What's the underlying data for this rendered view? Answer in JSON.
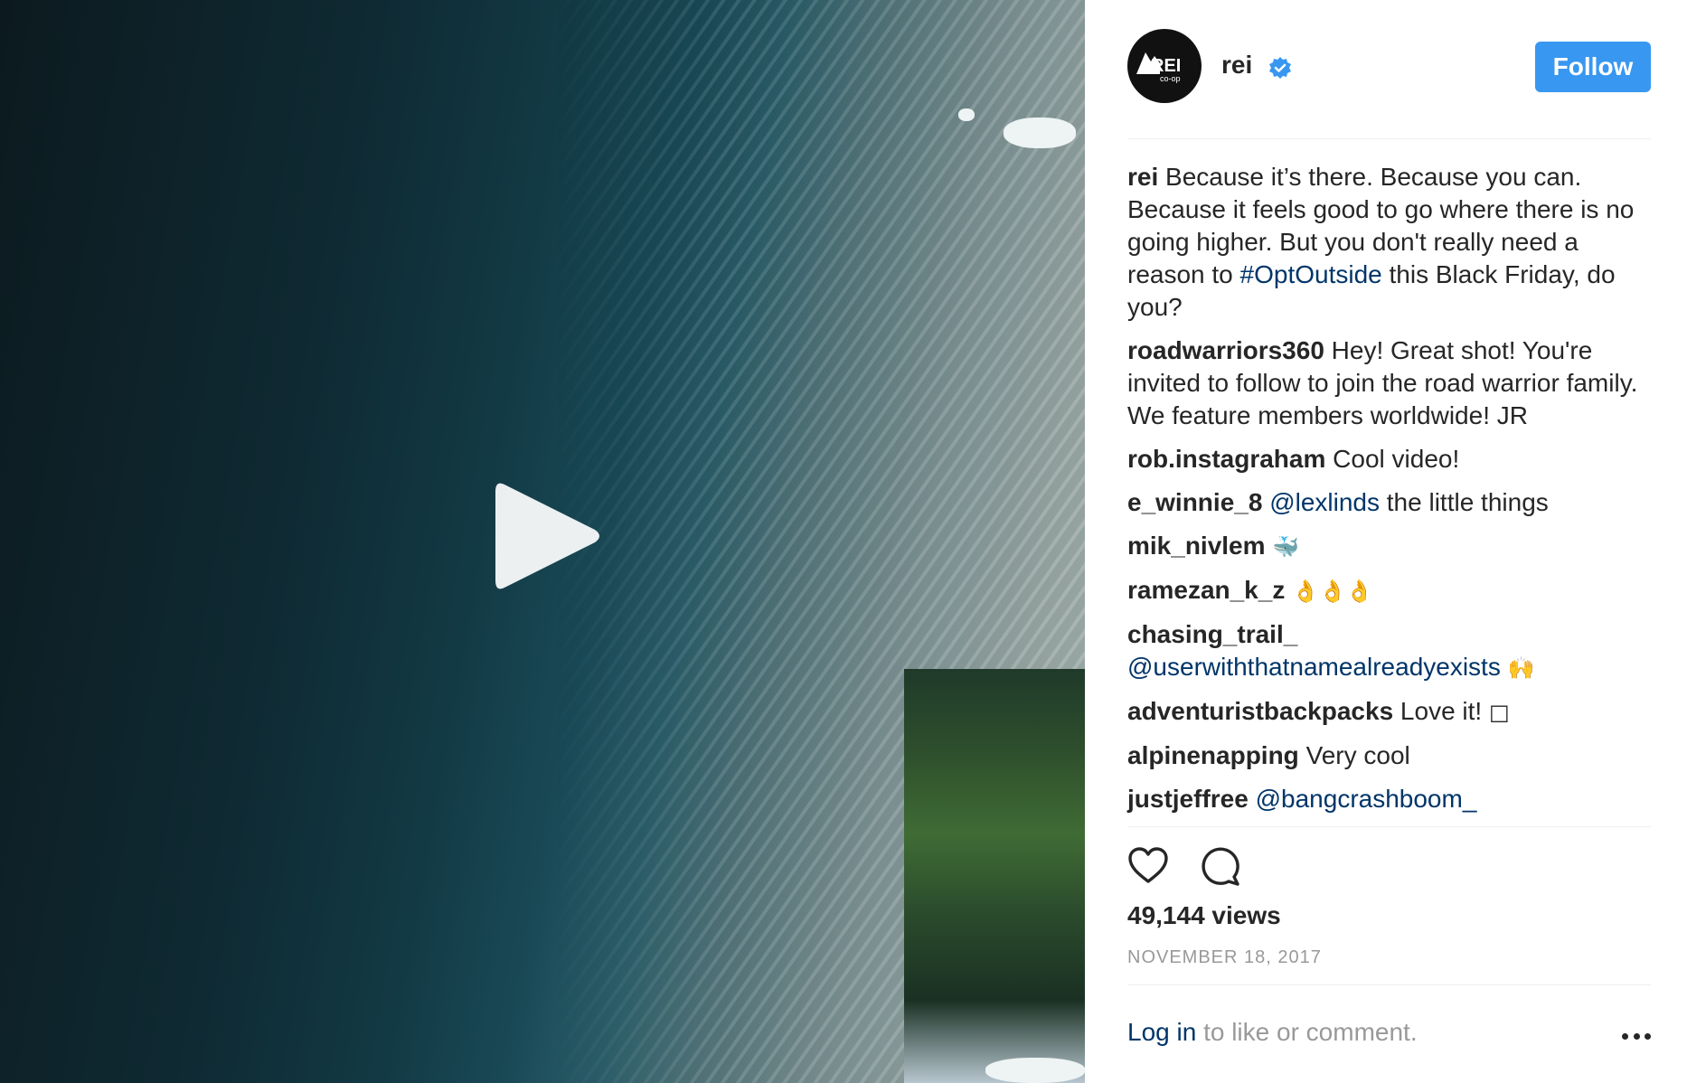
{
  "post": {
    "media": {
      "play_icon": "play-icon"
    },
    "header": {
      "username": "rei",
      "avatar_text": "REI",
      "avatar_subtext": "co-op",
      "verified_icon": "verified-badge-icon",
      "follow_label": "Follow"
    },
    "comments": [
      {
        "author": "rei",
        "segments": [
          {
            "text": "Because it’s there. Because you can. Because it feels good to go where there is no going higher. But you don't really need a reason to "
          },
          {
            "text": "#OptOutside",
            "link": true
          },
          {
            "text": " this Black Friday, do you?"
          }
        ]
      },
      {
        "author": "roadwarriors360",
        "segments": [
          {
            "text": "Hey! Great shot! You're invited to follow to join the road warrior family. We feature members worldwide! JR"
          }
        ]
      },
      {
        "author": "rob.instagraham",
        "segments": [
          {
            "text": "Cool video!"
          }
        ]
      },
      {
        "author": "e_winnie_8",
        "segments": [
          {
            "text": "@lexlinds",
            "link": true
          },
          {
            "text": " the little things"
          }
        ]
      },
      {
        "author": "mik_nivlem",
        "segments": [
          {
            "text": "🐳",
            "emoji": true
          }
        ]
      },
      {
        "author": "ramezan_k_z",
        "segments": [
          {
            "text": "👌👌👌",
            "emoji": true
          }
        ]
      },
      {
        "author": "chasing_trail_",
        "segments": [
          {
            "text": "@userwiththatnamealreadyexists",
            "link": true
          },
          {
            "text": " "
          },
          {
            "text": "🙌",
            "emoji": true
          }
        ]
      },
      {
        "author": "adventuristbackpacks",
        "segments": [
          {
            "text": "Love it! "
          },
          {
            "text": "□",
            "emoji": true
          }
        ]
      },
      {
        "author": "alpinenapping",
        "segments": [
          {
            "text": "Very cool"
          }
        ]
      },
      {
        "author": "justjeffree",
        "segments": [
          {
            "text": "@bangcrashboom_",
            "link": true
          }
        ]
      }
    ],
    "actions": {
      "like_icon": "heart-icon",
      "comment_icon": "comment-icon"
    },
    "views": "49,144 views",
    "date": "NOVEMBER 18, 2017",
    "footer": {
      "login_label": "Log in",
      "rest_text": " to like or comment.",
      "more_icon": "more-options-icon"
    }
  },
  "colors": {
    "follow_button": "#3897f0",
    "link": "#003569",
    "text": "#262626",
    "muted": "#999999",
    "divider": "#efefef"
  }
}
